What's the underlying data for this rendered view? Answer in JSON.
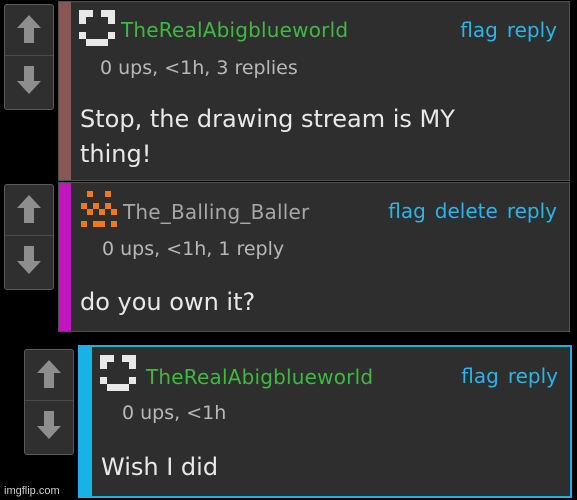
{
  "colors": {
    "background": "#000000",
    "panel": "#2e2e2e",
    "link": "#29b5e8",
    "username_green": "#3fb93f",
    "username_gray": "#a7a7a7",
    "stripe_1": "#8a5656",
    "stripe_2": "#c414c4",
    "stripe_3": "#17b2e6"
  },
  "comments": [
    {
      "username": "TheRealAbigblueworld",
      "avatar_icon": "smiley-face-icon",
      "actions": {
        "flag": "flag",
        "reply": "reply"
      },
      "meta": "0 ups, <1h, 3 replies",
      "body": "Stop, the drawing stream is MY thing!"
    },
    {
      "username": "The_Balling_Baller",
      "avatar_icon": "orange-pixel-face-icon",
      "actions": {
        "flag": "flag",
        "delete": "delete",
        "reply": "reply"
      },
      "meta": "0 ups, <1h, 1 reply",
      "body": "do you own it?"
    },
    {
      "username": "TheRealAbigblueworld",
      "avatar_icon": "smiley-face-icon",
      "actions": {
        "flag": "flag",
        "reply": "reply"
      },
      "meta": "0 ups, <1h",
      "body": "Wish I did"
    }
  ],
  "watermark": "imgflip.com"
}
